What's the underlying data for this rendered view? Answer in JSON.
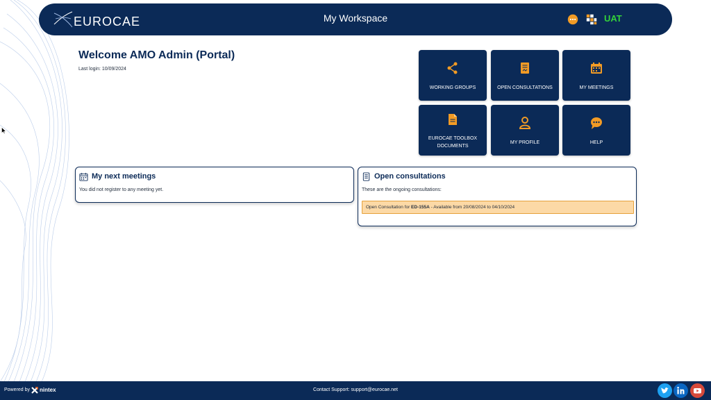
{
  "header": {
    "brand": "EUROCAE",
    "title": "My Workspace",
    "env_label": "UAT",
    "chat_icon": "chat-icon",
    "apps_icon": "apps-grid-icon"
  },
  "welcome": {
    "title": "Welcome AMO Admin (Portal)",
    "last_login": "Last login: 10/09/2024"
  },
  "tiles": [
    {
      "label": "WORKING GROUPS",
      "icon": "share-icon"
    },
    {
      "label": "OPEN CONSULTATIONS",
      "icon": "document-icon"
    },
    {
      "label": "MY MEETINGS",
      "icon": "calendar-icon"
    },
    {
      "label_line1": "EUROCAE TOOLBOX",
      "label_line2": "DOCUMENTS",
      "icon": "file-icon"
    },
    {
      "label": "MY PROFILE",
      "icon": "user-icon"
    },
    {
      "label": "HELP",
      "icon": "chat-bubble-icon"
    }
  ],
  "meetings_card": {
    "title": "My next meetings",
    "text": "You did not register to any meeting yet."
  },
  "consultations_card": {
    "title": "Open consultations",
    "text": "These are the ongoing consultations:",
    "item": {
      "prefix": "Open Consultation for ",
      "code": "ED-155A",
      "suffix": " - Available from 20/08/2024 to 04/10/2024"
    }
  },
  "footer": {
    "powered_by": "Powered by",
    "vendor": "nintex",
    "support": "Contact Support: support@eurocae.net",
    "social": [
      "twitter-icon",
      "linkedin-icon",
      "youtube-icon"
    ]
  },
  "colors": {
    "navy": "#0b2a57",
    "accent_orange": "#f29b25",
    "consult_highlight": "#fcd9a6",
    "env_green": "#33d13a",
    "twitter": "#1da1f2",
    "linkedin": "#0a66c2",
    "youtube": "#d64a3b"
  }
}
